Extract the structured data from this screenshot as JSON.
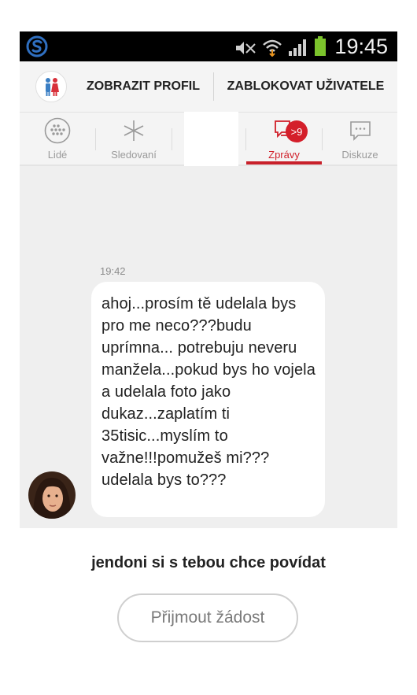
{
  "status_bar": {
    "time": "19:45",
    "icons": [
      "app-logo-icon",
      "mute-icon",
      "wifi-icon",
      "signal-icon",
      "battery-icon"
    ]
  },
  "action_bar": {
    "view_profile_label": "ZOBRAZIT PROFIL",
    "block_user_label": "ZABLOKOVAT UŽIVATELE"
  },
  "tabs": [
    {
      "label": "Lidé",
      "icon": "people-grid-icon"
    },
    {
      "label": "Sledovaní",
      "icon": "star-icon"
    },
    {
      "label": "Zprávy",
      "icon": "messages-icon",
      "badge": ">9",
      "active": true
    },
    {
      "label": "Diskuze",
      "icon": "discussion-icon"
    }
  ],
  "conversation": {
    "timestamp": "19:42",
    "message": "ahoj...prosím tě udelala bys pro me neco???budu uprímna... potrebuju neveru manžela...pokud bys ho vojela a udelala foto jako dukaz...zaplatím ti 35tisic...myslím to važne!!!pomužeš mi???udelala bys to???"
  },
  "request": {
    "prompt": "jendoni si s tebou chce povídat",
    "accept_label": "Přijmout žádost"
  },
  "colors": {
    "accent": "#d01e28",
    "chat_background": "#efefef",
    "bar_background": "#f4f4f4"
  }
}
